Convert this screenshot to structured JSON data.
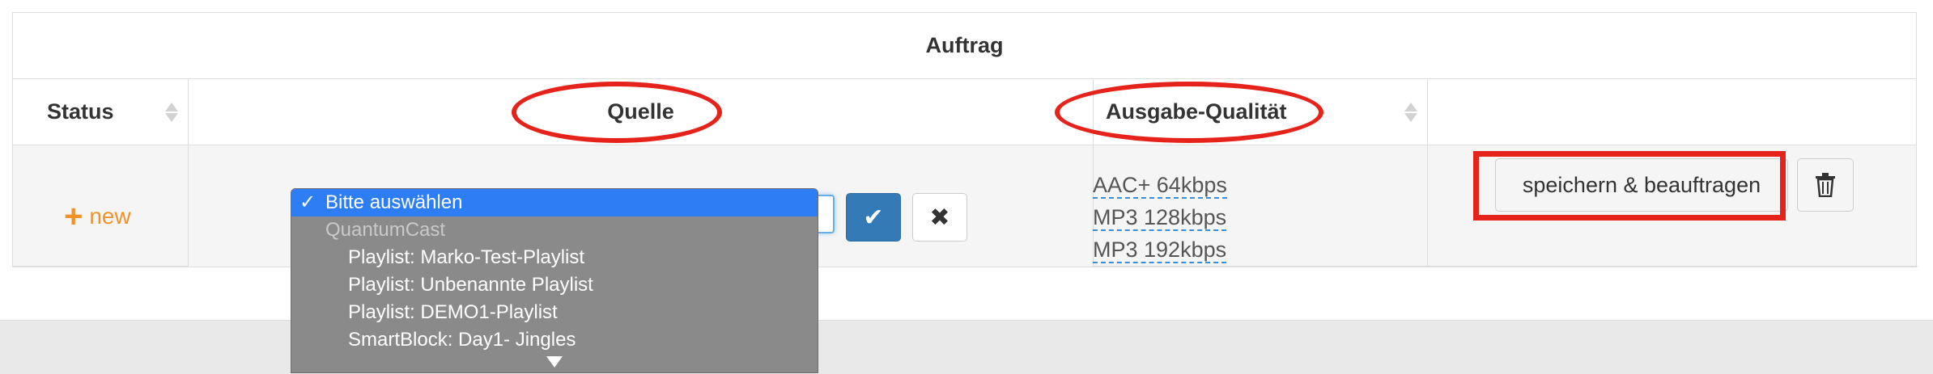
{
  "table": {
    "title": "Auftrag",
    "columns": {
      "status": "Status",
      "source": "Quelle",
      "quality": "Ausgabe-Qualität"
    }
  },
  "row": {
    "new_label": "new",
    "new_icon": "plus-icon",
    "quality_options": [
      "AAC+ 64kbps",
      "MP3 128kbps",
      "MP3 192kbps"
    ],
    "save_button": "speichern & beauftragen",
    "delete_icon": "trash-icon",
    "confirm_icon": "checkmark-icon",
    "cancel_icon": "close-icon"
  },
  "dropdown": {
    "selected": "Bitte auswählen",
    "check": "✓",
    "group": "QuantumCast",
    "items": [
      "Playlist: Marko-Test-Playlist",
      "Playlist: Unbenannte Playlist",
      "Playlist: DEMO1-Playlist",
      "SmartBlock: Day1- Jingles"
    ]
  },
  "colors": {
    "accent": "#337ab7",
    "new_link": "#f0922a",
    "highlight": "#e5231b",
    "selected_option": "#2d7ef5"
  }
}
